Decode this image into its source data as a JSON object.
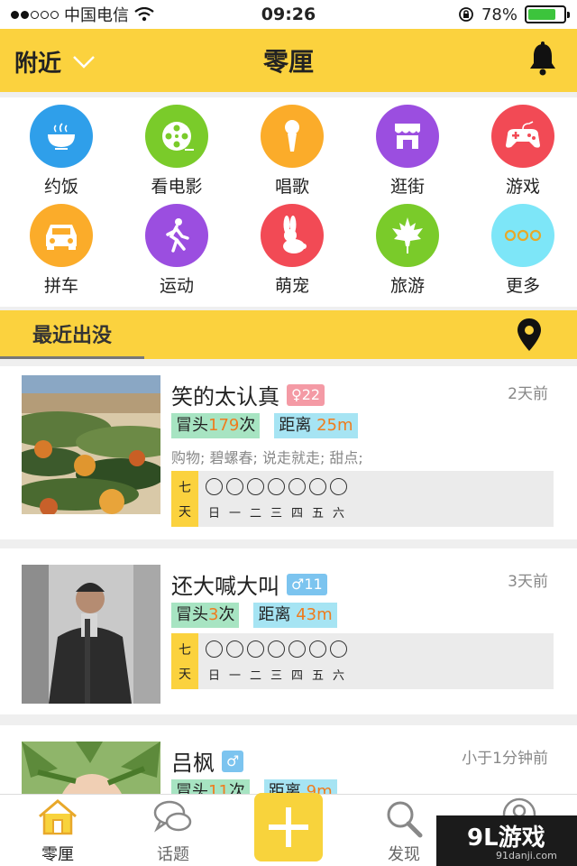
{
  "status_bar": {
    "carrier": "中国电信",
    "time": "09:26",
    "battery": "78%",
    "battery_level": 0.78
  },
  "header": {
    "location": "附近",
    "title": "零厘"
  },
  "categories": [
    {
      "label": "约饭",
      "icon": "bowl-icon",
      "color": "#2f9fea"
    },
    {
      "label": "看电影",
      "icon": "film-reel-icon",
      "color": "#7acb2a"
    },
    {
      "label": "唱歌",
      "icon": "microphone-icon",
      "color": "#fbac2a"
    },
    {
      "label": "逛街",
      "icon": "shop-icon",
      "color": "#9b4ee0"
    },
    {
      "label": "游戏",
      "icon": "gamepad-icon",
      "color": "#f24a55"
    },
    {
      "label": "拼车",
      "icon": "car-icon",
      "color": "#fbac2a"
    },
    {
      "label": "运动",
      "icon": "walking-person-icon",
      "color": "#9b4ee0"
    },
    {
      "label": "萌宠",
      "icon": "rabbit-icon",
      "color": "#f24a55"
    },
    {
      "label": "旅游",
      "icon": "maple-leaf-icon",
      "color": "#7acb2a"
    },
    {
      "label": "更多",
      "icon": "more-dots-icon",
      "color": "#7de6f8"
    }
  ],
  "section": {
    "title": "最近出没"
  },
  "users": [
    {
      "name": "笑的太认真",
      "gender_symbol": "♀",
      "age": "22",
      "time": "2天前",
      "appear_prefix": "冒头",
      "appear_count": "179",
      "appear_suffix": "次",
      "distance_prefix": "距离",
      "distance": "25m",
      "interests": "购物; 碧螺春; 说走就走; 甜点;"
    },
    {
      "name": "还大喊大叫",
      "gender_symbol": "♂",
      "age": "11",
      "time": "3天前",
      "appear_prefix": "冒头",
      "appear_count": "3",
      "appear_suffix": "次",
      "distance_prefix": "距离",
      "distance": "43m",
      "interests": ""
    },
    {
      "name": "吕枫",
      "gender_symbol": "♂",
      "age": "",
      "time": "小于1分钟前",
      "appear_prefix": "冒头",
      "appear_count": "11",
      "appear_suffix": "次",
      "distance_prefix": "距离",
      "distance": "9m",
      "interests": ""
    }
  ],
  "week": {
    "side_top": "七",
    "side_bottom": "天",
    "days": [
      "日",
      "一",
      "二",
      "三",
      "四",
      "五",
      "六"
    ]
  },
  "tabs": [
    {
      "label": "零厘",
      "icon": "house-icon"
    },
    {
      "label": "话题",
      "icon": "chat-bubbles-icon"
    },
    {
      "label": "",
      "icon": "plus-icon"
    },
    {
      "label": "发现",
      "icon": "magnifier-icon"
    },
    {
      "label": "",
      "icon": "profile-icon"
    }
  ],
  "watermark": {
    "brand": "9L游戏",
    "url": "91danji.com"
  }
}
